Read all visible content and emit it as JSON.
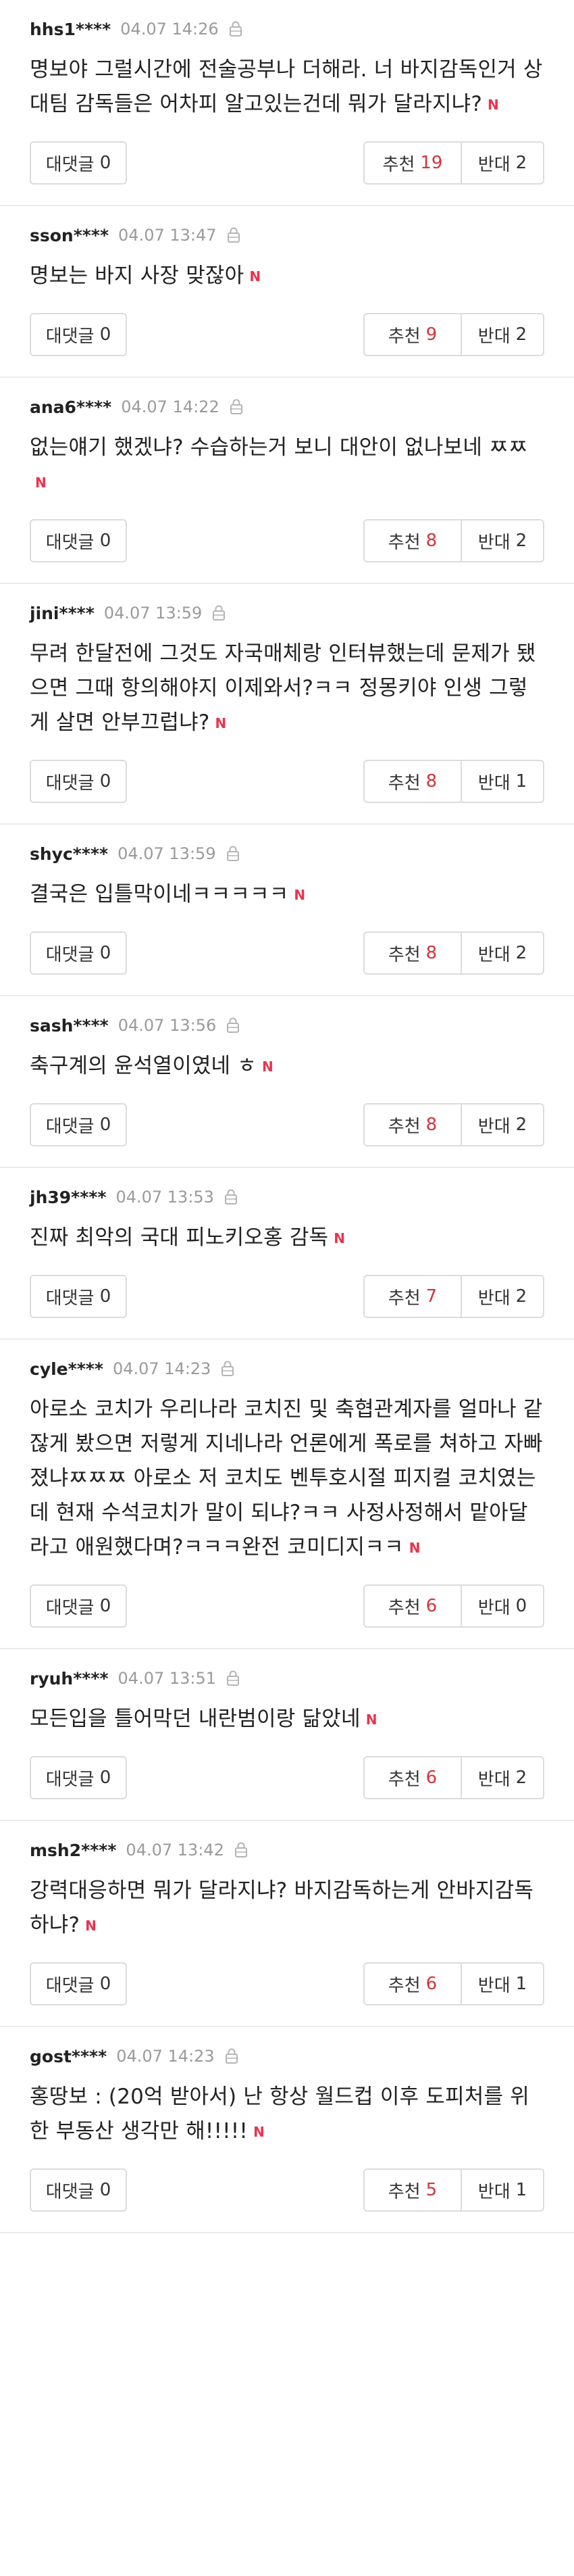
{
  "labels": {
    "reply": "대댓글",
    "up": "추천",
    "down": "반대",
    "new_badge": "N"
  },
  "comments": [
    {
      "user": "hhs1****",
      "date": "04.07 14:26",
      "text": "명보야 그럴시간에 전술공부나 더해라. 너 바지감독인거 상대팀 감독들은 어차피 알고있는건데 뭐가 달라지냐?",
      "replies": "0",
      "up": "19",
      "down": "2"
    },
    {
      "user": "sson****",
      "date": "04.07 13:47",
      "text": "명보는 바지 사장 맞잖아",
      "replies": "0",
      "up": "9",
      "down": "2"
    },
    {
      "user": "ana6****",
      "date": "04.07 14:22",
      "text": "없는얘기 했겠냐? 수습하는거 보니 대안이 없나보네 ㅉㅉ",
      "replies": "0",
      "up": "8",
      "down": "2"
    },
    {
      "user": "jini****",
      "date": "04.07 13:59",
      "text": "무려 한달전에 그것도 자국매체랑 인터뷰했는데 문제가 됐으면 그때 항의해야지 이제와서?ㅋㅋ 정몽키야 인생 그렇게 살면 안부끄럽냐?",
      "replies": "0",
      "up": "8",
      "down": "1"
    },
    {
      "user": "shyc****",
      "date": "04.07 13:59",
      "text": "결국은 입틀막이네ㅋㅋㅋㅋㅋ",
      "replies": "0",
      "up": "8",
      "down": "2"
    },
    {
      "user": "sash****",
      "date": "04.07 13:56",
      "text": "축구계의 윤석열이였네 ㅎ",
      "replies": "0",
      "up": "8",
      "down": "2"
    },
    {
      "user": "jh39****",
      "date": "04.07 13:53",
      "text": "진짜 최악의 국대 피노키오홍 감독",
      "replies": "0",
      "up": "7",
      "down": "2"
    },
    {
      "user": "cyle****",
      "date": "04.07 14:23",
      "text": "아로소 코치가 우리나라 코치진 및 축협관계자를 얼마나 같잖게 봤으면 저렇게 지네나라 언론에게 폭로를 쳐하고 자빠졌냐ㅉㅉㅉ 아로소 저 코치도 벤투호시절 피지컬 코치였는데 현재 수석코치가 말이 되냐?ㅋㅋ 사정사정해서 맡아달라고 애원했다며?ㅋㅋㅋ완전 코미디지ㅋㅋ",
      "replies": "0",
      "up": "6",
      "down": "0"
    },
    {
      "user": "ryuh****",
      "date": "04.07 13:51",
      "text": "모든입을 틀어막던 내란범이랑 닮았네",
      "replies": "0",
      "up": "6",
      "down": "2"
    },
    {
      "user": "msh2****",
      "date": "04.07 13:42",
      "text": "강력대응하면 뭐가 달라지냐? 바지감독하는게 안바지감독하냐?",
      "replies": "0",
      "up": "6",
      "down": "1"
    },
    {
      "user": "gost****",
      "date": "04.07 14:23",
      "text": "홍땅보 : (20억 받아서) 난 항상 월드컵 이후 도피처를 위한 부동산 생각만 해!!!!!",
      "replies": "0",
      "up": "5",
      "down": "1"
    }
  ]
}
